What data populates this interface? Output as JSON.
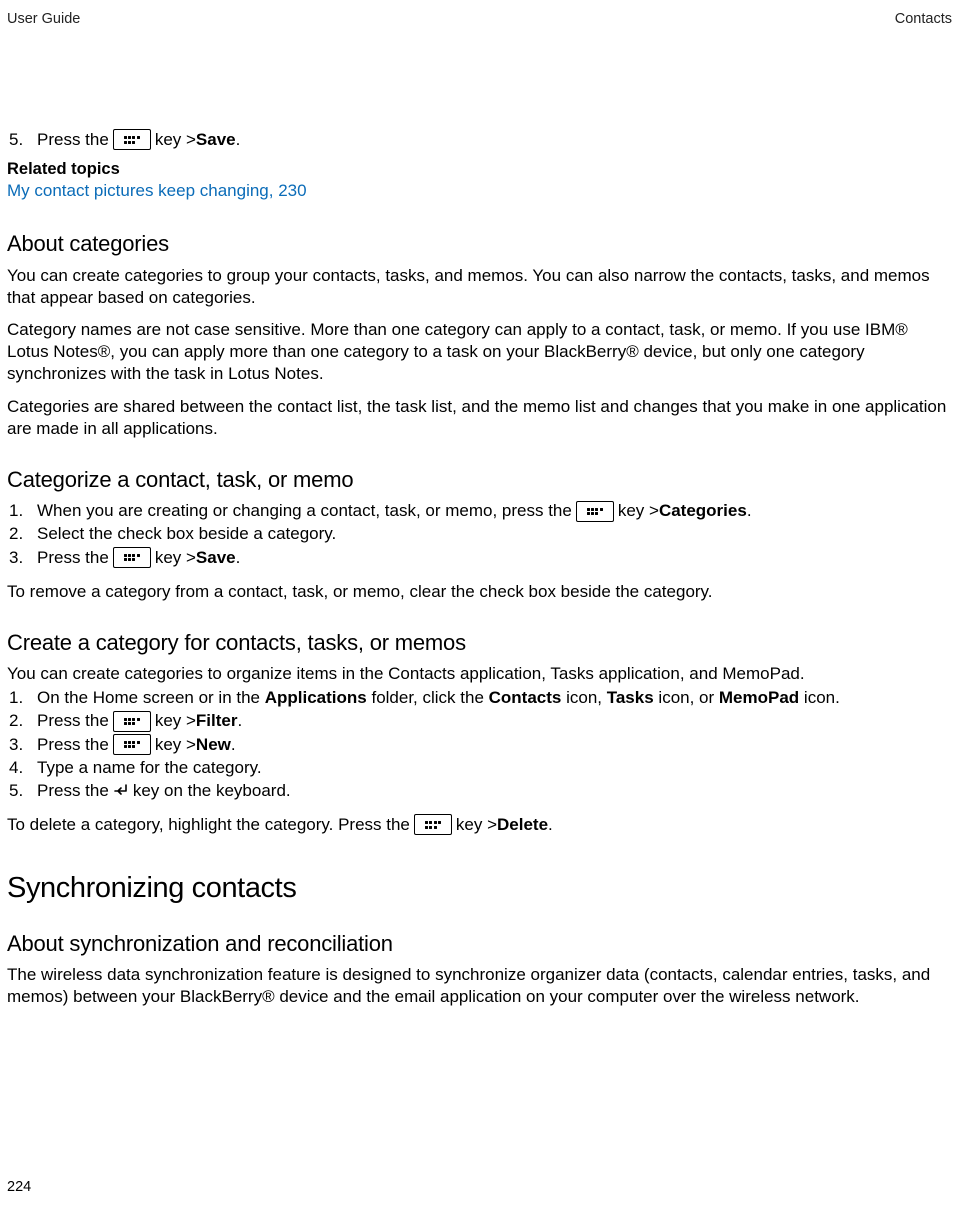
{
  "header": {
    "left": "User Guide",
    "right": "Contacts"
  },
  "topStep": {
    "num": "5.",
    "pre": "Press the ",
    "post": " key > ",
    "bold": "Save",
    "end": "."
  },
  "related": {
    "heading": "Related topics",
    "link": "My contact pictures keep changing, 230"
  },
  "aboutCategories": {
    "heading": "About categories",
    "p1": "You can create categories to group your contacts, tasks, and memos. You can also narrow the contacts, tasks, and memos that appear based on categories.",
    "p2": "Category names are not case sensitive. More than one category can apply to a contact, task, or memo. If you use IBM® Lotus Notes®, you can apply more than one category to a task on your BlackBerry® device, but only one category synchronizes with the task in Lotus Notes.",
    "p3": "Categories are shared between the contact list, the task list, and the memo list and changes that you make in one application are made in all applications."
  },
  "categorize": {
    "heading": "Categorize a contact, task, or memo",
    "s1": {
      "num": "1.",
      "pre": "When you are creating or changing a contact, task, or memo, press the ",
      "post": " key > ",
      "bold": "Categories",
      "end": "."
    },
    "s2": {
      "num": "2.",
      "text": "Select the check box beside a category."
    },
    "s3": {
      "num": "3.",
      "pre": "Press the ",
      "post": " key > ",
      "bold": "Save",
      "end": "."
    },
    "after": "To remove a category from a contact, task, or memo, clear the check box beside the category."
  },
  "createCat": {
    "heading": "Create a category for contacts, tasks, or memos",
    "intro": "You can create categories to organize items in the Contacts application, Tasks application, and MemoPad.",
    "s1": {
      "num": "1.",
      "pre": "On the Home screen or in the ",
      "b1": "Applications",
      "mid1": " folder, click the ",
      "b2": "Contacts",
      "mid2": " icon, ",
      "b3": "Tasks",
      "mid3": " icon, or ",
      "b4": "MemoPad",
      "end": " icon."
    },
    "s2": {
      "num": "2.",
      "pre": "Press the ",
      "post": " key > ",
      "bold": "Filter",
      "end": "."
    },
    "s3": {
      "num": "3.",
      "pre": "Press the ",
      "post": " key > ",
      "bold": "New",
      "end": "."
    },
    "s4": {
      "num": "4.",
      "text": "Type a name for the category."
    },
    "s5": {
      "num": "5.",
      "pre": "Press the ",
      "post": " key on the keyboard."
    },
    "afterPre": "To delete a category, highlight the category. Press the ",
    "afterPost": " key > ",
    "afterBold": "Delete",
    "afterEnd": "."
  },
  "sync": {
    "heading": "Synchronizing contacts",
    "sub": "About synchronization and reconciliation",
    "p1": "The wireless data synchronization feature is designed to synchronize organizer data (contacts, calendar entries, tasks, and memos) between your BlackBerry® device and the email application on your computer over the wireless network."
  },
  "pageNumber": "224"
}
